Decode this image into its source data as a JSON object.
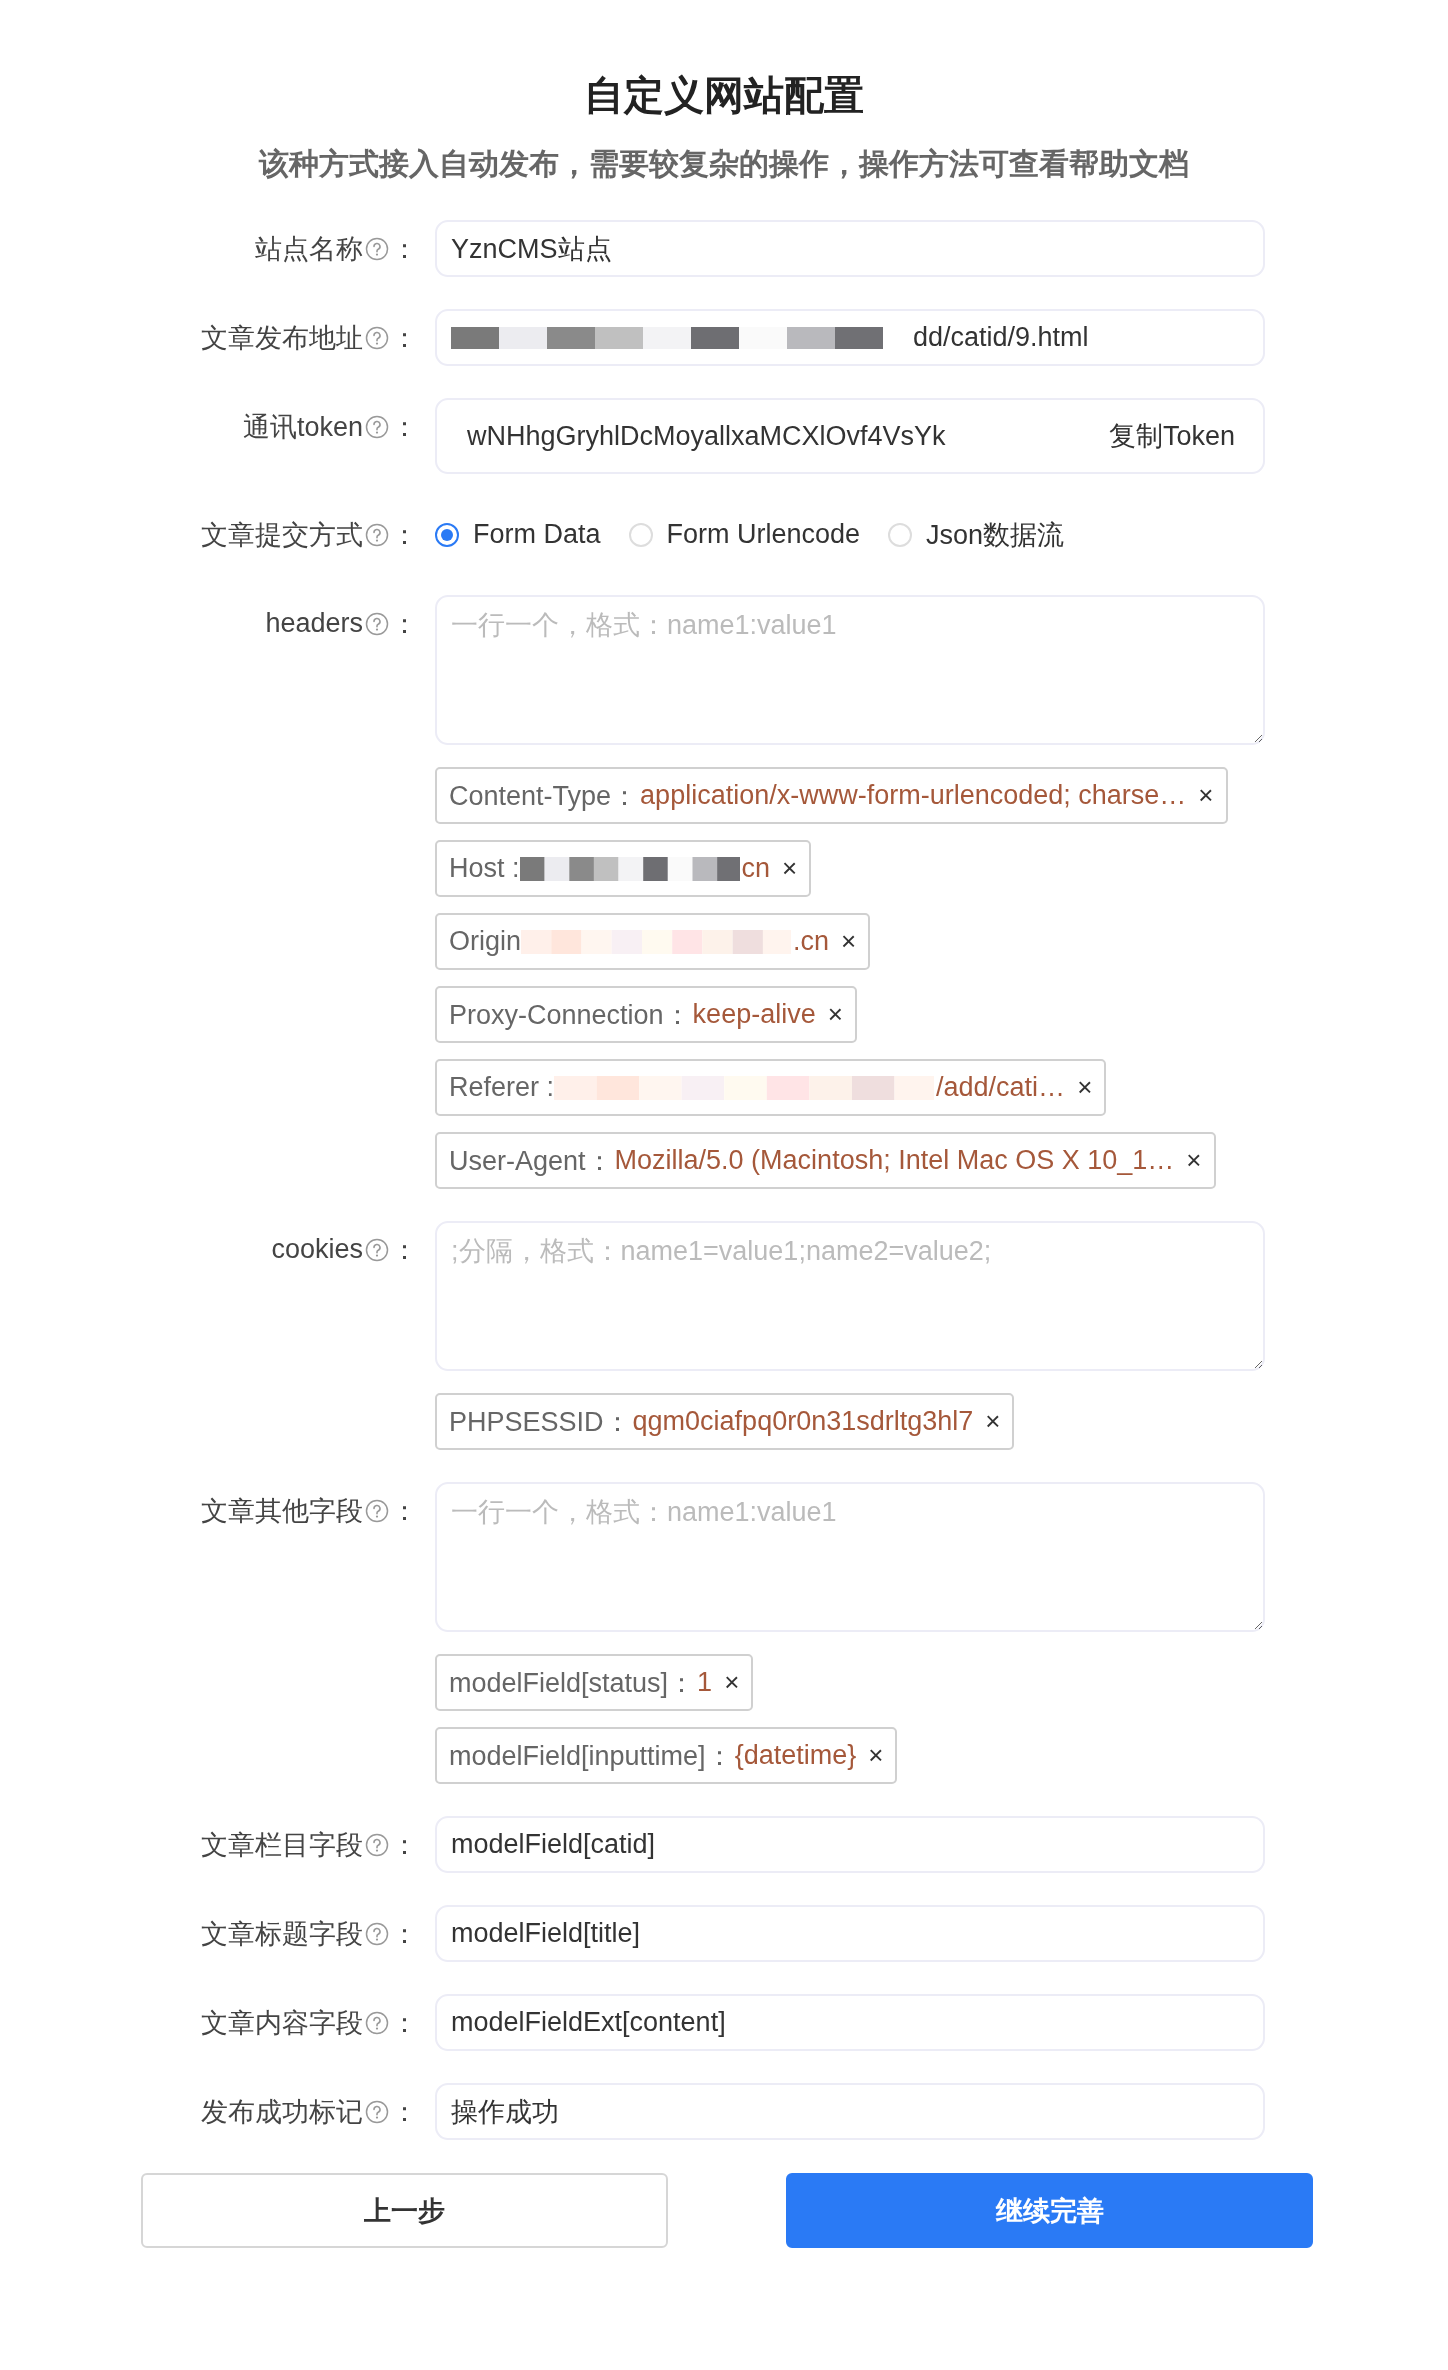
{
  "title": "自定义网站配置",
  "subtitle": "该种方式接入自动发布，需要较复杂的操作，操作方法可查看帮助文档",
  "fields": [
    {
      "kind": "input",
      "label": "站点名称",
      "colon": "：",
      "value": "YznCMS站点"
    },
    {
      "kind": "input",
      "label": "文章发布地址",
      "colon": "：",
      "redacted": true,
      "value": "dd/catid/9.html"
    },
    {
      "kind": "token",
      "label": "通讯token",
      "colon": "：",
      "value": "wNHhgGryhlDcMoyallxaMCXlOvf4VsYk",
      "action": "复制Token"
    },
    {
      "kind": "radio",
      "label": "文章提交方式",
      "colon": "：",
      "options": [
        {
          "label": "Form Data",
          "selected": true
        },
        {
          "label": "Form Urlencode",
          "selected": false
        },
        {
          "label": "Json数据流",
          "selected": false
        }
      ]
    },
    {
      "kind": "textarea",
      "label": "headers",
      "colon": "：",
      "placeholder": "一行一个，格式：name1:value1",
      "tags": [
        {
          "key": "Content-Type：",
          "value": "application/x-www-form-urlencoded; charse…",
          "close": "×"
        },
        {
          "key": "Host :",
          "redacted": true,
          "value": "cn",
          "close": "×"
        },
        {
          "key": "Origin",
          "redacted": true,
          "value": ".cn",
          "close": "×"
        },
        {
          "key": "Proxy-Connection：",
          "value": "keep-alive",
          "close": "×"
        },
        {
          "key": "Referer :",
          "redacted": true,
          "value": "/add/cati…",
          "close": "×"
        },
        {
          "key": "User-Agent：",
          "value": "Mozilla/5.0 (Macintosh; Intel Mac OS X 10_1…",
          "close": "×"
        }
      ]
    },
    {
      "kind": "textarea",
      "label": "cookies",
      "colon": "：",
      "placeholder": ";分隔，格式：name1=value1;name2=value2;",
      "tags": [
        {
          "key": "PHPSESSID：",
          "value": "qgm0ciafpq0r0n31sdrltg3hl7",
          "close": "×"
        }
      ]
    },
    {
      "kind": "textarea",
      "label": "文章其他字段",
      "colon": "：",
      "placeholder": "一行一个，格式：name1:value1",
      "tags": [
        {
          "key": "modelField[status]：",
          "value": "1",
          "close": "×"
        },
        {
          "key": "modelField[inputtime]：",
          "value": "{datetime}",
          "close": "×"
        }
      ]
    },
    {
      "kind": "input",
      "label": "文章栏目字段",
      "colon": "：",
      "value": "modelField[catid]"
    },
    {
      "kind": "input",
      "label": "文章标题字段",
      "colon": "：",
      "value": "modelField[title]"
    },
    {
      "kind": "input",
      "label": "文章内容字段",
      "colon": "：",
      "value": "modelFieldExt[content]"
    },
    {
      "kind": "input",
      "label": "发布成功标记",
      "colon": "：",
      "value": "操作成功"
    }
  ],
  "buttons": [
    {
      "label": "上一步",
      "kind": "secondary"
    },
    {
      "label": "继续完善",
      "kind": "primary"
    }
  ]
}
